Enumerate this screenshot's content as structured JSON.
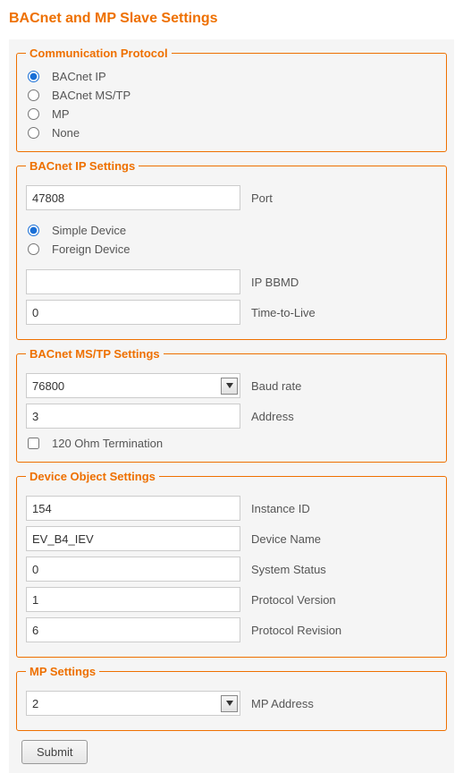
{
  "title": "BACnet and MP Slave Settings",
  "comm_protocol": {
    "legend": "Communication Protocol",
    "options": {
      "ip": {
        "label": "BACnet IP",
        "checked": true
      },
      "mstp": {
        "label": "BACnet MS/TP",
        "checked": false
      },
      "mp": {
        "label": "MP",
        "checked": false
      },
      "none": {
        "label": "None",
        "checked": false
      }
    }
  },
  "bacnet_ip": {
    "legend": "BACnet IP Settings",
    "port": {
      "label": "Port",
      "value": "47808"
    },
    "device_type": {
      "simple": {
        "label": "Simple Device",
        "checked": true
      },
      "foreign": {
        "label": "Foreign Device",
        "checked": false
      }
    },
    "bbmd": {
      "label": "IP BBMD",
      "value": ""
    },
    "ttl": {
      "label": "Time-to-Live",
      "value": "0"
    }
  },
  "bacnet_mstp": {
    "legend": "BACnet MS/TP Settings",
    "baud": {
      "label": "Baud rate",
      "value": "76800"
    },
    "address": {
      "label": "Address",
      "value": "3"
    },
    "termination": {
      "label": "120 Ohm Termination",
      "checked": false
    }
  },
  "device_object": {
    "legend": "Device Object Settings",
    "instance_id": {
      "label": "Instance ID",
      "value": "154"
    },
    "device_name": {
      "label": "Device Name",
      "value": "EV_B4_IEV"
    },
    "sys_status": {
      "label": "System Status",
      "value": "0"
    },
    "proto_ver": {
      "label": "Protocol Version",
      "value": "1"
    },
    "proto_rev": {
      "label": "Protocol Revision",
      "value": "6"
    }
  },
  "mp_settings": {
    "legend": "MP Settings",
    "address": {
      "label": "MP Address",
      "value": "2"
    }
  },
  "submit_label": "Submit"
}
